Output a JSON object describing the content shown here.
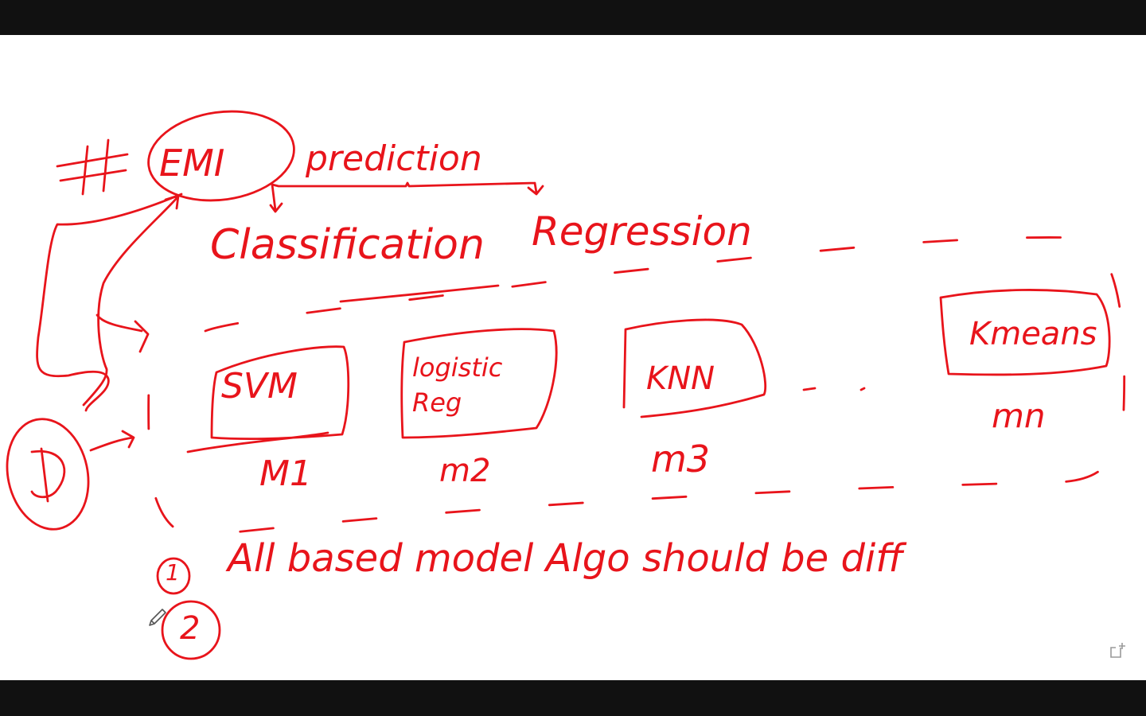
{
  "colors": {
    "ink": "#e8141b",
    "board": "#ffffff",
    "letterbox": "#111111",
    "ui_icon": "#9a9a9a"
  },
  "heading": {
    "hash": "#",
    "circled": "EMI",
    "rest": "prediction"
  },
  "branches": {
    "left": "Classification",
    "right": "Regression"
  },
  "models": [
    {
      "box": "SVM",
      "tag": "M1"
    },
    {
      "box": "logistic Reg",
      "tag": "m2"
    },
    {
      "box": "KNN",
      "tag": "m3"
    },
    {
      "box": "Kmeans",
      "tag": "mn"
    }
  ],
  "dataset_label": "D",
  "notes": [
    {
      "number": "1",
      "text": "All based model Algo should be diff"
    },
    {
      "number": "2",
      "text": ""
    }
  ],
  "icons": {
    "tool": "pen-icon",
    "new_board": "new-board-icon"
  }
}
